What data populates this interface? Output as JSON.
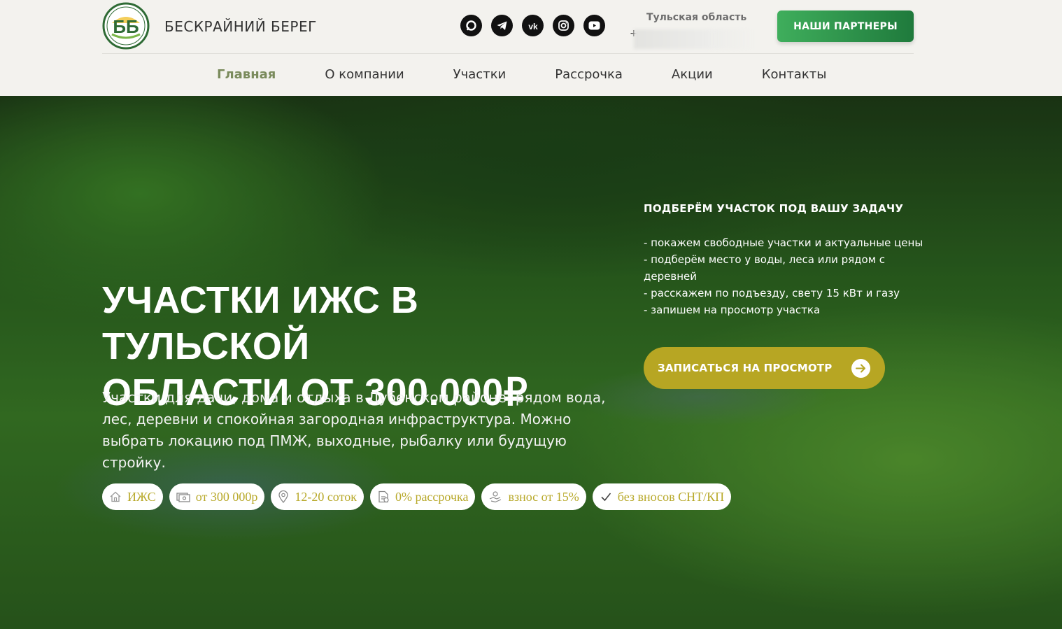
{
  "header": {
    "logo_text": "ББ",
    "brand_name": "БЕСКРАЙНИЙ БЕРЕГ",
    "region": "Тульская область",
    "phone_prefix": "+",
    "partners_button": "НАШИ ПАРТНЕРЫ",
    "socials": [
      "max-icon",
      "telegram-icon",
      "vk-icon",
      "instagram-icon",
      "youtube-icon"
    ]
  },
  "nav": {
    "items": [
      {
        "label": "Главная",
        "active": true
      },
      {
        "label": "О компании"
      },
      {
        "label": "Участки"
      },
      {
        "label": "Рассрочка"
      },
      {
        "label": "Акции"
      },
      {
        "label": "Контакты"
      }
    ]
  },
  "hero": {
    "title_line1": "УЧАСТКИ ИЖС В ТУЛЬСКОЙ",
    "title_line2": "ОБЛАСТИ ОТ 300.000₽",
    "description": "Участки для дачи, дома и отдыха в Дубенском районе: рядом вода, лес, деревни и спокойная загородная инфраструктура. Можно выбрать локацию под ПМЖ, выходные, рыбалку или будущую стройку.",
    "tags": [
      {
        "icon": "house-icon",
        "label": "ИЖС"
      },
      {
        "icon": "money-icon",
        "label": "от 300 000р"
      },
      {
        "icon": "location-pin-icon",
        "label": "12-20 соток"
      },
      {
        "icon": "document-icon",
        "label": "0% рассрочка"
      },
      {
        "icon": "coins-hand-icon",
        "label": "взнос от 15%"
      },
      {
        "icon": "checkmark-icon",
        "label": "без вносов СНТ/КП"
      }
    ]
  },
  "side": {
    "title": "ПОДБЕРЁМ УЧАСТОК ПОД ВАШУ ЗАДАЧУ",
    "items": [
      "- покажем свободные участки и актуальные цены",
      "- подберём место у воды, леса или рядом с деревней",
      "- расскажем по подъезду, свету 15 кВт и газу",
      "- запишем на просмотр участка"
    ],
    "cta": "ЗАПИСАТЬСЯ НА ПРОСМОТР"
  },
  "colors": {
    "accent_olive": "#b7a623",
    "partners_green": "#2a9148",
    "nav_active": "#7a8b5c"
  }
}
